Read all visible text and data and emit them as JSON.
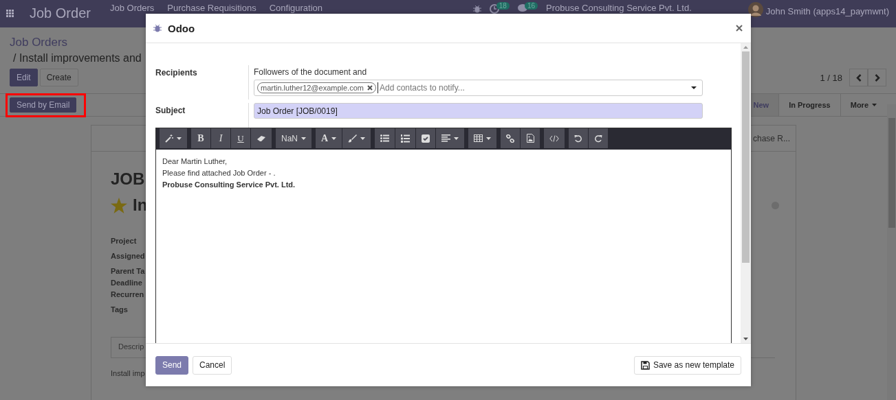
{
  "topbar": {
    "app_name": "Job Order",
    "menu": [
      "Job Orders",
      "Purchase Requisitions",
      "Configuration"
    ],
    "activity_count": "18",
    "message_count": "16",
    "company": "Probuse Consulting Service Pvt. Ltd.",
    "user": "John Smith (apps14_paymwnt)"
  },
  "breadcrumb": [
    "Job Orders",
    "/ Install improvements and"
  ],
  "actions": [
    "Edit",
    "Create"
  ],
  "pager": "1 / 18",
  "header_buttons": [
    {
      "label": "Send by Email",
      "highlighted": true
    }
  ],
  "stages": [
    {
      "label": "New",
      "selected": true
    },
    {
      "label": "In Progress",
      "selected": false
    },
    {
      "label": "More",
      "selected": false
    }
  ],
  "sheet": {
    "tab_text": "chase R...",
    "reference": "JOB",
    "starred": true,
    "title": "In",
    "fields": [
      "Project",
      "Assigned",
      "Parent Ta",
      "Deadline",
      "Recurren",
      "Tags"
    ],
    "notebook_tab": "Descrip",
    "description": "Install imp"
  },
  "dialog": {
    "title": "Odoo",
    "recipients_label": "Recipients",
    "followers_text": "Followers of the document and",
    "recipient_tags": [
      "martin.luther12@example.com"
    ],
    "recipients_placeholder": "Add contacts to notify...",
    "subject_label": "Subject",
    "subject": "Job Order [JOB/0019]",
    "toolbar": [
      [
        {
          "kind": "wand",
          "caret": true
        }
      ],
      [
        {
          "kind": "text",
          "text": "B",
          "caret": false
        },
        {
          "kind": "text",
          "text": "I",
          "caret": false
        },
        {
          "kind": "text",
          "text": "U",
          "caret": false
        },
        {
          "kind": "eraser",
          "caret": false
        }
      ],
      [
        {
          "kind": "text",
          "text": "NaN",
          "caret": true
        }
      ],
      [
        {
          "kind": "text",
          "text": "A",
          "caret": true
        },
        {
          "kind": "brush",
          "caret": true
        }
      ],
      [
        {
          "kind": "list",
          "caret": false
        },
        {
          "kind": "numbered",
          "caret": false
        },
        {
          "kind": "checkbox",
          "caret": false
        },
        {
          "kind": "align",
          "caret": true
        }
      ],
      [
        {
          "kind": "table",
          "caret": true
        }
      ],
      [
        {
          "kind": "link",
          "caret": false
        },
        {
          "kind": "image",
          "caret": false
        }
      ],
      [
        {
          "kind": "code",
          "caret": false
        }
      ],
      [
        {
          "kind": "undo",
          "caret": false
        },
        {
          "kind": "redo",
          "caret": false
        }
      ]
    ],
    "body": [
      {
        "text": "Dear Martin Luther,",
        "bold": false
      },
      {
        "text": "Please find attached Job Order - .",
        "bold": false
      },
      {
        "text": "Probuse Consulting Service Pvt. Ltd.",
        "bold": true
      }
    ],
    "buttons": {
      "send": "Send",
      "cancel": "Cancel",
      "template": "Save as new template"
    }
  }
}
